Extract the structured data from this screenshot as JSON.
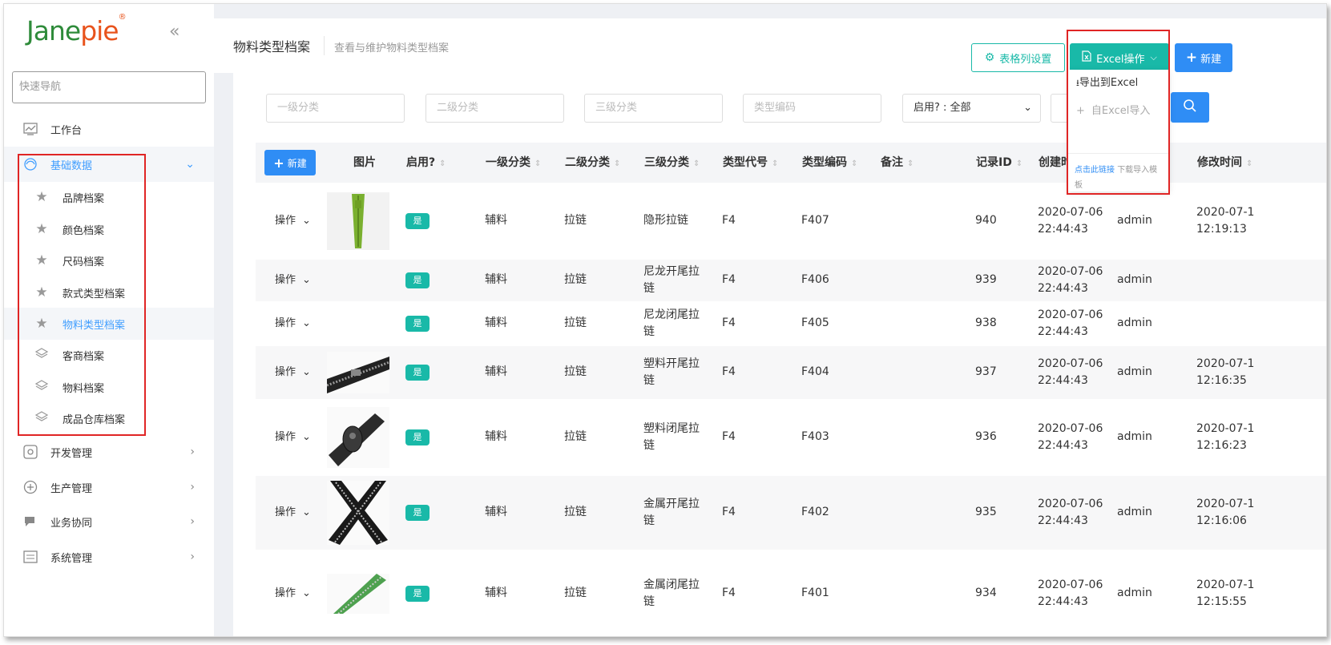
{
  "app": {
    "logo_main": "Jane",
    "logo_accent": "pie",
    "logo_mark": "®"
  },
  "sidebar": {
    "collapse_glyph": "«",
    "quicknav_placeholder": "快速导航",
    "items": [
      {
        "label": "工作台",
        "icon": "dashboard-icon"
      },
      {
        "label": "基础数据",
        "icon": "base-data-icon"
      },
      {
        "label": "开发管理",
        "icon": "dev-icon"
      },
      {
        "label": "生产管理",
        "icon": "production-icon"
      },
      {
        "label": "业务协同",
        "icon": "chat-icon"
      },
      {
        "label": "系统管理",
        "icon": "system-icon"
      }
    ],
    "sub_items": [
      {
        "label": "品牌档案",
        "icon": "star-icon"
      },
      {
        "label": "颜色档案",
        "icon": "star-icon"
      },
      {
        "label": "尺码档案",
        "icon": "star-icon"
      },
      {
        "label": "款式类型档案",
        "icon": "star-icon"
      },
      {
        "label": "物料类型档案",
        "icon": "star-icon"
      },
      {
        "label": "客商档案",
        "icon": "layers-icon"
      },
      {
        "label": "物料档案",
        "icon": "layers-icon"
      },
      {
        "label": "成品仓库档案",
        "icon": "layers-icon"
      }
    ]
  },
  "header": {
    "title": "物料类型档案",
    "subtitle": "查看与维护物料类型档案",
    "btn_columns": "表格列设置",
    "btn_excel": "Excel操作",
    "btn_new": "新建"
  },
  "excel_menu": {
    "export": "导出到Excel",
    "import": "自Excel导入",
    "link_text": "点击此链接",
    "link_suffix": "下载导入模板"
  },
  "filters": {
    "level1": "一级分类",
    "level2": "二级分类",
    "level3": "三级分类",
    "type_code": "类型编码",
    "enabled": "启用? : 全部"
  },
  "table": {
    "new_button": "新建",
    "columns": [
      "图片",
      "启用?",
      "一级分类",
      "二级分类",
      "三级分类",
      "类型代号",
      "类型编码",
      "备注",
      "记录ID",
      "创建时",
      "修改时间"
    ],
    "op_label": "操作",
    "rows": [
      {
        "img": "green-zipper",
        "enabled": "是",
        "l1": "辅料",
        "l2": "拉链",
        "l3": "隐形拉链",
        "code": "F4",
        "typecode": "F407",
        "remark": "",
        "id": "940",
        "created_date": "2020-07-06",
        "created_time": "22:44:43",
        "creator": "admin",
        "modified_date": "2020-07-1",
        "modified_time": "12:19:13"
      },
      {
        "img": "",
        "enabled": "是",
        "l1": "辅料",
        "l2": "拉链",
        "l3": "尼龙开尾拉链",
        "code": "F4",
        "typecode": "F406",
        "remark": "",
        "id": "939",
        "created_date": "2020-07-06",
        "created_time": "22:44:43",
        "creator": "admin",
        "modified_date": "",
        "modified_time": ""
      },
      {
        "img": "",
        "enabled": "是",
        "l1": "辅料",
        "l2": "拉链",
        "l3": "尼龙闭尾拉链",
        "code": "F4",
        "typecode": "F405",
        "remark": "",
        "id": "938",
        "created_date": "2020-07-06",
        "created_time": "22:44:43",
        "creator": "admin",
        "modified_date": "",
        "modified_time": ""
      },
      {
        "img": "black-zipper",
        "enabled": "是",
        "l1": "辅料",
        "l2": "拉链",
        "l3": "塑料开尾拉链",
        "code": "F4",
        "typecode": "F404",
        "remark": "",
        "id": "937",
        "created_date": "2020-07-06",
        "created_time": "22:44:43",
        "creator": "admin",
        "modified_date": "2020-07-1",
        "modified_time": "12:16:35"
      },
      {
        "img": "black-zipper-pull",
        "enabled": "是",
        "l1": "辅料",
        "l2": "拉链",
        "l3": "塑料闭尾拉链",
        "code": "F4",
        "typecode": "F403",
        "remark": "",
        "id": "936",
        "created_date": "2020-07-06",
        "created_time": "22:44:43",
        "creator": "admin",
        "modified_date": "2020-07-1",
        "modified_time": "12:16:23"
      },
      {
        "img": "metal-zipper-x",
        "enabled": "是",
        "l1": "辅料",
        "l2": "拉链",
        "l3": "金属开尾拉链",
        "code": "F4",
        "typecode": "F402",
        "remark": "",
        "id": "935",
        "created_date": "2020-07-06",
        "created_time": "22:44:43",
        "creator": "admin",
        "modified_date": "2020-07-1",
        "modified_time": "12:16:06"
      },
      {
        "img": "green-metal-zipper",
        "enabled": "是",
        "l1": "辅料",
        "l2": "拉链",
        "l3": "金属闭尾拉链",
        "code": "F4",
        "typecode": "F401",
        "remark": "",
        "id": "934",
        "created_date": "2020-07-06",
        "created_time": "22:44:43",
        "creator": "admin",
        "modified_date": "2020-07-1",
        "modified_time": "12:15:55"
      }
    ]
  },
  "colors": {
    "accent": "#409eff",
    "teal": "#19b9a8",
    "blue": "#2f8df5",
    "highlight": "#e02525"
  }
}
